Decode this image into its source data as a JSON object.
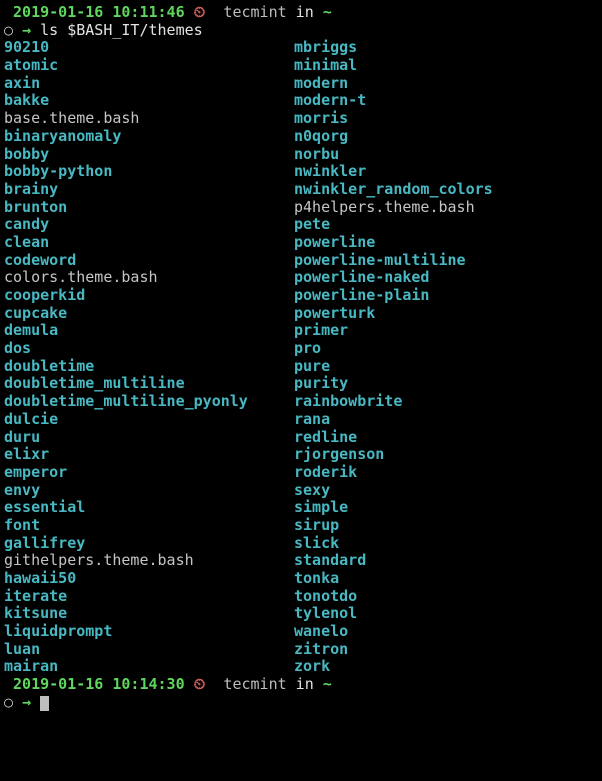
{
  "prompt1": {
    "timestamp": "2019-01-16 10:11:46",
    "clock_icon": "⏲",
    "user": "tecmint",
    "in": "in",
    "path": "~",
    "circle": "○",
    "arrow": "→",
    "command": "ls $BASH_IT/themes"
  },
  "col1": [
    {
      "name": "90210",
      "type": "dir"
    },
    {
      "name": "atomic",
      "type": "dir"
    },
    {
      "name": "axin",
      "type": "dir"
    },
    {
      "name": "bakke",
      "type": "dir"
    },
    {
      "name": "base.theme.bash",
      "type": "file"
    },
    {
      "name": "binaryanomaly",
      "type": "dir"
    },
    {
      "name": "bobby",
      "type": "dir"
    },
    {
      "name": "bobby-python",
      "type": "dir"
    },
    {
      "name": "brainy",
      "type": "dir"
    },
    {
      "name": "brunton",
      "type": "dir"
    },
    {
      "name": "candy",
      "type": "dir"
    },
    {
      "name": "clean",
      "type": "dir"
    },
    {
      "name": "codeword",
      "type": "dir"
    },
    {
      "name": "colors.theme.bash",
      "type": "file"
    },
    {
      "name": "cooperkid",
      "type": "dir"
    },
    {
      "name": "cupcake",
      "type": "dir"
    },
    {
      "name": "demula",
      "type": "dir"
    },
    {
      "name": "dos",
      "type": "dir"
    },
    {
      "name": "doubletime",
      "type": "dir"
    },
    {
      "name": "doubletime_multiline",
      "type": "dir"
    },
    {
      "name": "doubletime_multiline_pyonly",
      "type": "dir"
    },
    {
      "name": "dulcie",
      "type": "dir"
    },
    {
      "name": "duru",
      "type": "dir"
    },
    {
      "name": "elixr",
      "type": "dir"
    },
    {
      "name": "emperor",
      "type": "dir"
    },
    {
      "name": "envy",
      "type": "dir"
    },
    {
      "name": "essential",
      "type": "dir"
    },
    {
      "name": "font",
      "type": "dir"
    },
    {
      "name": "gallifrey",
      "type": "dir"
    },
    {
      "name": "githelpers.theme.bash",
      "type": "file"
    },
    {
      "name": "hawaii50",
      "type": "dir"
    },
    {
      "name": "iterate",
      "type": "dir"
    },
    {
      "name": "kitsune",
      "type": "dir"
    },
    {
      "name": "liquidprompt",
      "type": "dir"
    },
    {
      "name": "luan",
      "type": "dir"
    },
    {
      "name": "mairan",
      "type": "dir"
    }
  ],
  "col2": [
    {
      "name": "mbriggs",
      "type": "dir"
    },
    {
      "name": "minimal",
      "type": "dir"
    },
    {
      "name": "modern",
      "type": "dir"
    },
    {
      "name": "modern-t",
      "type": "dir"
    },
    {
      "name": "morris",
      "type": "dir"
    },
    {
      "name": "n0qorg",
      "type": "dir"
    },
    {
      "name": "norbu",
      "type": "dir"
    },
    {
      "name": "nwinkler",
      "type": "dir"
    },
    {
      "name": "nwinkler_random_colors",
      "type": "dir"
    },
    {
      "name": "p4helpers.theme.bash",
      "type": "file"
    },
    {
      "name": "pete",
      "type": "dir"
    },
    {
      "name": "powerline",
      "type": "dir"
    },
    {
      "name": "powerline-multiline",
      "type": "dir"
    },
    {
      "name": "powerline-naked",
      "type": "dir"
    },
    {
      "name": "powerline-plain",
      "type": "dir"
    },
    {
      "name": "powerturk",
      "type": "dir"
    },
    {
      "name": "primer",
      "type": "dir"
    },
    {
      "name": "pro",
      "type": "dir"
    },
    {
      "name": "pure",
      "type": "dir"
    },
    {
      "name": "purity",
      "type": "dir"
    },
    {
      "name": "rainbowbrite",
      "type": "dir"
    },
    {
      "name": "rana",
      "type": "dir"
    },
    {
      "name": "redline",
      "type": "dir"
    },
    {
      "name": "rjorgenson",
      "type": "dir"
    },
    {
      "name": "roderik",
      "type": "dir"
    },
    {
      "name": "sexy",
      "type": "dir"
    },
    {
      "name": "simple",
      "type": "dir"
    },
    {
      "name": "sirup",
      "type": "dir"
    },
    {
      "name": "slick",
      "type": "dir"
    },
    {
      "name": "standard",
      "type": "dir"
    },
    {
      "name": "tonka",
      "type": "dir"
    },
    {
      "name": "tonotdo",
      "type": "dir"
    },
    {
      "name": "tylenol",
      "type": "dir"
    },
    {
      "name": "wanelo",
      "type": "dir"
    },
    {
      "name": "zitron",
      "type": "dir"
    },
    {
      "name": "zork",
      "type": "dir"
    }
  ],
  "prompt2": {
    "timestamp": "2019-01-16 10:14:30",
    "clock_icon": "⏲",
    "user": "tecmint",
    "in": "in",
    "path": "~",
    "circle": "○",
    "arrow": "→"
  }
}
